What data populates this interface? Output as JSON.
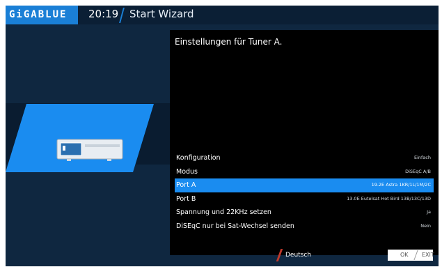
{
  "header": {
    "logo": "GiGABLUE",
    "time": "20:19",
    "title": "Start Wizard"
  },
  "panel": {
    "title": "Einstellungen für Tuner A.",
    "rows": [
      {
        "label": "Konfiguration",
        "value": "Einfach"
      },
      {
        "label": "Modus",
        "value": "DiSEqC A/B"
      },
      {
        "label": "Port A",
        "value": "19.2E Astra 1KR/1L/1M/2C"
      },
      {
        "label": "Port B",
        "value": "13.0E Eutelsat Hot Bird 13B/13C/13D"
      },
      {
        "label": "Spannung und 22KHz setzen",
        "value": "Ja"
      },
      {
        "label": "DiSEqC nur bei Sat-Wechsel senden",
        "value": "Nein"
      }
    ],
    "selected_row": 2
  },
  "footer": {
    "language": "Deutsch",
    "ok": "OK",
    "exit": "EXIT"
  },
  "colors": {
    "accent": "#1a8cf0",
    "background": "#0f2740",
    "panel": "#000000",
    "language_marker": "#c0392b"
  },
  "icons": {
    "tuner": "receiver-icon"
  }
}
